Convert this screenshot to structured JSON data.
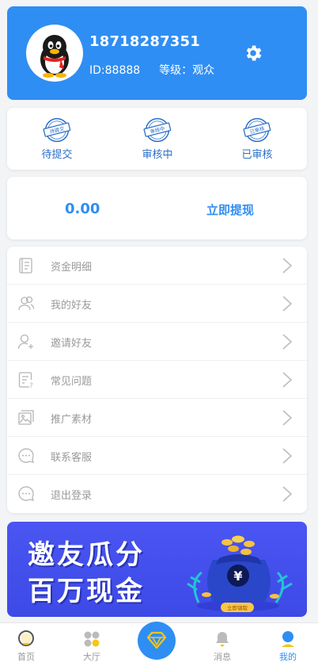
{
  "profile": {
    "phone": "18718287351",
    "id_text": "ID:88888",
    "level_text": "等级：观众"
  },
  "status": {
    "items": [
      {
        "stamp": "待提交",
        "label": "待提交"
      },
      {
        "stamp": "审核中",
        "label": "审核中"
      },
      {
        "stamp": "已审核",
        "label": "已审核"
      }
    ]
  },
  "wallet": {
    "balance": "0.00",
    "withdraw_label": "立即提现"
  },
  "menu": {
    "items": [
      {
        "label": "资金明细",
        "icon": "ledger-icon"
      },
      {
        "label": "我的好友",
        "icon": "friends-icon"
      },
      {
        "label": "邀请好友",
        "icon": "invite-user-icon"
      },
      {
        "label": "常见问题",
        "icon": "faq-icon"
      },
      {
        "label": "推广素材",
        "icon": "image-gallery-icon"
      },
      {
        "label": "联系客服",
        "icon": "chat-bubble-icon"
      },
      {
        "label": "退出登录",
        "icon": "chat-bubble-icon"
      }
    ]
  },
  "banner": {
    "line1": "邀友瓜分",
    "line2": "百万现金",
    "button_text": "立即領取",
    "currency_symbol": "¥"
  },
  "tabbar": {
    "items": [
      {
        "label": "首页",
        "icon": "home-bubble-icon",
        "active": false
      },
      {
        "label": "大厅",
        "icon": "hall-dots-icon",
        "active": false
      },
      {
        "label": "",
        "icon": "diamond-icon",
        "active": false
      },
      {
        "label": "消息",
        "icon": "bell-icon",
        "active": false
      },
      {
        "label": "我的",
        "icon": "user-icon",
        "active": true
      }
    ]
  },
  "colors": {
    "primary": "#2f8ef3",
    "stamp_blue": "#2a6ec9",
    "banner_bg": "#4350ee",
    "menu_text": "#9a9a9a"
  }
}
